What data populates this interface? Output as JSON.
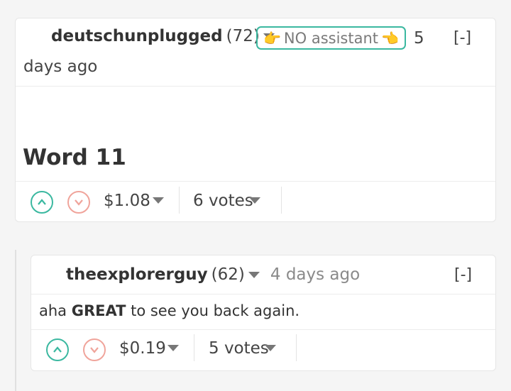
{
  "post": {
    "author": "deutschunplugged",
    "reputation": "(72)",
    "badge_text": "NO assistant",
    "time_part1": "5",
    "time_part2": "days ago",
    "collapse": "[-]",
    "title": "Word 11",
    "payout": "$1.08",
    "votes": "6 votes"
  },
  "reply": {
    "author": "theexplorerguy",
    "reputation": "(62)",
    "time": "4 days ago",
    "collapse": "[-]",
    "body_pre": "aha ",
    "body_bold": "GREAT",
    "body_post": " to see you back again.",
    "payout": "$0.19",
    "votes": "5 votes"
  },
  "colors": {
    "upvote": "#3bb8a0",
    "downvote": "#f0a49b",
    "badge_border": "#3bb8a0"
  },
  "icons": [
    "upvote-icon",
    "downvote-icon",
    "dropdown-caret-icon",
    "pointing-right-hand-icon",
    "pointing-left-hand-icon"
  ]
}
